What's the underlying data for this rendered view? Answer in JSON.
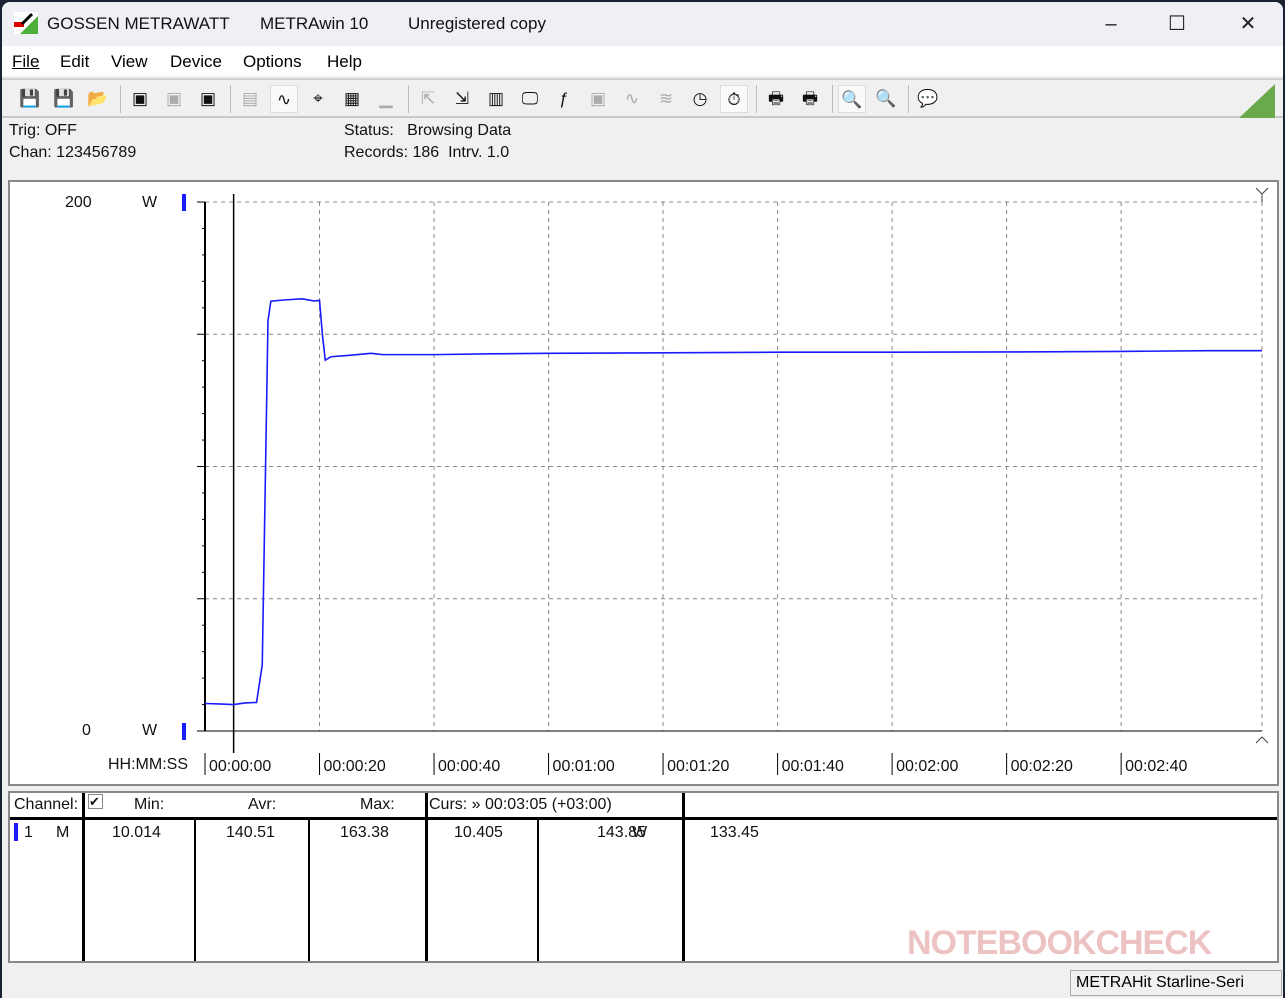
{
  "window": {
    "brand": "GOSSEN METRAWATT",
    "app": "METRAwin 10",
    "registration": "Unregistered copy",
    "controls": {
      "minimize": "–",
      "maximize": "☐",
      "close": "✕"
    }
  },
  "menu": [
    "File",
    "Edit",
    "View",
    "Device",
    "Options",
    "Help"
  ],
  "toolbar": [
    {
      "icon": "save-export-icon",
      "glyph": "💾",
      "state": "normal"
    },
    {
      "icon": "save-import-icon",
      "glyph": "💾",
      "state": "normal"
    },
    {
      "icon": "open-folder-icon",
      "glyph": "📂",
      "state": "normal"
    },
    {
      "sep": true
    },
    {
      "icon": "device-read-icon",
      "glyph": "▣",
      "state": "normal"
    },
    {
      "icon": "device-clear-icon",
      "glyph": "▣",
      "state": "disabled"
    },
    {
      "icon": "memory-read-icon",
      "glyph": "▣",
      "state": "normal"
    },
    {
      "sep": true
    },
    {
      "icon": "display-icon",
      "glyph": "▤",
      "state": "disabled"
    },
    {
      "icon": "waveform-view-icon",
      "glyph": "∿",
      "state": "active"
    },
    {
      "icon": "crosshair-icon",
      "glyph": "⌖",
      "state": "normal"
    },
    {
      "icon": "table-view-icon",
      "glyph": "▦",
      "state": "normal"
    },
    {
      "icon": "histogram-icon",
      "glyph": "▁",
      "state": "disabled"
    },
    {
      "sep": true
    },
    {
      "icon": "transfer-out-icon",
      "glyph": "⇱",
      "state": "disabled"
    },
    {
      "icon": "transfer-in-icon",
      "glyph": "⇲",
      "state": "normal"
    },
    {
      "icon": "config-icon",
      "glyph": "▥",
      "state": "normal"
    },
    {
      "icon": "monitor-icon",
      "glyph": "🖵",
      "state": "normal"
    },
    {
      "icon": "function-icon",
      "glyph": "ƒ",
      "state": "normal"
    },
    {
      "icon": "device-setup-icon",
      "glyph": "▣",
      "state": "disabled"
    },
    {
      "icon": "trigger-icon",
      "glyph": "∿",
      "state": "disabled"
    },
    {
      "icon": "sampling-icon",
      "glyph": "≋",
      "state": "disabled"
    },
    {
      "icon": "clock-settings-icon",
      "glyph": "◷",
      "state": "normal"
    },
    {
      "icon": "timer-icon",
      "glyph": "⏱",
      "state": "active"
    },
    {
      "sep": true
    },
    {
      "icon": "print-chart-icon",
      "glyph": "🖶",
      "state": "normal"
    },
    {
      "icon": "print-icon",
      "glyph": "🖶",
      "state": "normal"
    },
    {
      "sep": true
    },
    {
      "icon": "zoom-waveform-icon",
      "glyph": "🔍",
      "state": "active"
    },
    {
      "icon": "zoom-out-icon",
      "glyph": "🔍",
      "state": "normal"
    },
    {
      "sep": true
    },
    {
      "icon": "comment-icon",
      "glyph": "💬",
      "state": "normal"
    }
  ],
  "info": {
    "trig": "Trig: OFF",
    "chan": "Chan:  123456789",
    "status_label": "Status:",
    "status_value": "Browsing Data",
    "records": "Records: 186",
    "interval": "Intrv. 1.0"
  },
  "chart_data": {
    "type": "line",
    "ylim": [
      0,
      200
    ],
    "y_tick_labels": [
      "200",
      "0"
    ],
    "y_unit": "W",
    "xlabel": "HH:MM:SS",
    "xlim": [
      0,
      184.6
    ],
    "x_tick_labels": [
      "00:00:00",
      "00:00:20",
      "00:00:40",
      "00:01:00",
      "00:01:20",
      "00:01:40",
      "00:02:00",
      "00:02:20",
      "00:02:40"
    ],
    "x_tick_values": [
      0,
      20,
      40,
      60,
      80,
      100,
      120,
      140,
      160
    ],
    "y_grid_values": [
      50,
      100,
      150
    ],
    "grid": true,
    "cursor_x": 5,
    "series": [
      {
        "color": "#1a1aff",
        "x": [
          0,
          3,
          5,
          7,
          9,
          10,
          11,
          11.5,
          14,
          17,
          19,
          20,
          20.5,
          21,
          22,
          25,
          29,
          31,
          40,
          50,
          60,
          80,
          100,
          120,
          140,
          160,
          175,
          184.6
        ],
        "y": [
          10.4,
          10.2,
          10.0,
          10.6,
          10.8,
          25,
          155,
          162.5,
          163,
          163.4,
          162.6,
          162.8,
          150,
          140.2,
          141.5,
          142,
          142.8,
          142.3,
          142.3,
          142.6,
          142.8,
          143,
          143.2,
          143.2,
          143.3,
          143.5,
          143.8,
          143.8
        ]
      }
    ]
  },
  "table": {
    "headers": {
      "channel": "Channel:",
      "min": "Min:",
      "avr": "Avr:",
      "max": "Max:",
      "cursor": "Curs: » 00:03:05 (+03:00)"
    },
    "rows": [
      {
        "ch": "1",
        "mode": "M",
        "min": "10.014",
        "avr": "140.51",
        "max": "163.38",
        "c1": "10.405",
        "c2": "143.85",
        "unit": "W",
        "c3": "133.45"
      }
    ]
  },
  "statusbar": {
    "device": "METRAHit Starline-Seri"
  },
  "watermark": "NOTEBOOKCHECK"
}
